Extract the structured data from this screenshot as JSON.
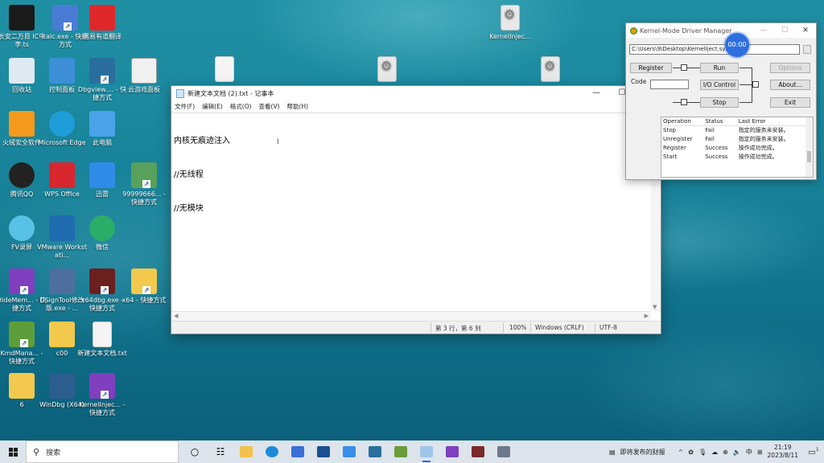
{
  "desktop_icons": [
    {
      "label": "长安二万目 IC中李.ts",
      "kind": "video"
    },
    {
      "label": "calc.exe - 快捷方式",
      "kind": "calc"
    },
    {
      "label": "网易有道翻译",
      "kind": "youdao"
    },
    {
      "label": "回收站",
      "kind": "recycle"
    },
    {
      "label": "控制面板",
      "kind": "control"
    },
    {
      "label": "Dbgview.... - 快捷方式",
      "kind": "dbgview"
    },
    {
      "label": "云游戏面板",
      "kind": "game"
    },
    {
      "label": "火绒安全软件",
      "kind": "huorong"
    },
    {
      "label": "Microsoft Edge",
      "kind": "edge"
    },
    {
      "label": "此电脑",
      "kind": "pc"
    },
    {
      "label": "腾讯QQ",
      "kind": "qq"
    },
    {
      "label": "WPS Office",
      "kind": "wps"
    },
    {
      "label": "迅雷",
      "kind": "xunlei"
    },
    {
      "label": "99999666... - 快捷方式",
      "kind": "app"
    },
    {
      "label": "FV录屏",
      "kind": "fv"
    },
    {
      "label": "VMware Workstati...",
      "kind": "vmware"
    },
    {
      "label": "微信",
      "kind": "wechat"
    },
    {
      "label": "HideMem... - 快捷方式",
      "kind": "vs"
    },
    {
      "label": "DSignTool修改版.exe - ...",
      "kind": "dsign"
    },
    {
      "label": "x64dbg.exe - 快捷方式",
      "kind": "x64dbg"
    },
    {
      "label": "x64 - 快捷方式",
      "kind": "folder"
    },
    {
      "label": "KmdMana... - 快捷方式",
      "kind": "kmd"
    },
    {
      "label": "c00",
      "kind": "folder"
    },
    {
      "label": "新建文本文档.txt",
      "kind": "file"
    },
    {
      "label": "6",
      "kind": "folder"
    },
    {
      "label": "WinDbg (X64)",
      "kind": "windbg"
    },
    {
      "label": "KernelInjec... - 快捷方式",
      "kind": "vs"
    },
    {
      "label": "KernelInjec...",
      "kind": "gear"
    }
  ],
  "notepad": {
    "title": "新建文本文档 (2).txt - 记事本",
    "menu": [
      "文件(F)",
      "编辑(E)",
      "格式(O)",
      "查看(V)",
      "帮助(H)"
    ],
    "lines": [
      "内核无痕迹注入",
      "//无线程",
      "//无模块"
    ],
    "status": {
      "position": "第 3 行，第 6 列",
      "zoom": "100%",
      "line_ending": "Windows (CRLF)",
      "encoding": "UTF-8"
    },
    "window_buttons": {
      "minimize": "—",
      "maximize": "☐",
      "close": "✕"
    }
  },
  "kdm": {
    "title": "Kernel-Mode Driver Manager",
    "path": "C:\\Users\\9\\Desktop\\KernelIject.sys",
    "buttons": {
      "register": "Register",
      "run": "Run",
      "options": "Options",
      "io_control": "I/O Control",
      "about": "About...",
      "stop": "Stop",
      "exit": "Exit"
    },
    "code_label": "Code",
    "table": {
      "headers": [
        "Operation",
        "Status",
        "Last Error"
      ],
      "rows": [
        [
          "Stop",
          "Fail",
          "指定的服务未安装。"
        ],
        [
          "Unregister",
          "Fail",
          "指定的服务未安装。"
        ],
        [
          "Register",
          "Success",
          "操作成功完成。"
        ],
        [
          "Start",
          "Success",
          "操作成功完成。"
        ]
      ]
    }
  },
  "recording_badge": "00:00",
  "taskbar": {
    "search_placeholder": "搜索",
    "news": "即将发布的财报",
    "ime": "中",
    "time": "21:19",
    "date": "2023/8/11",
    "notification_count": "1"
  }
}
